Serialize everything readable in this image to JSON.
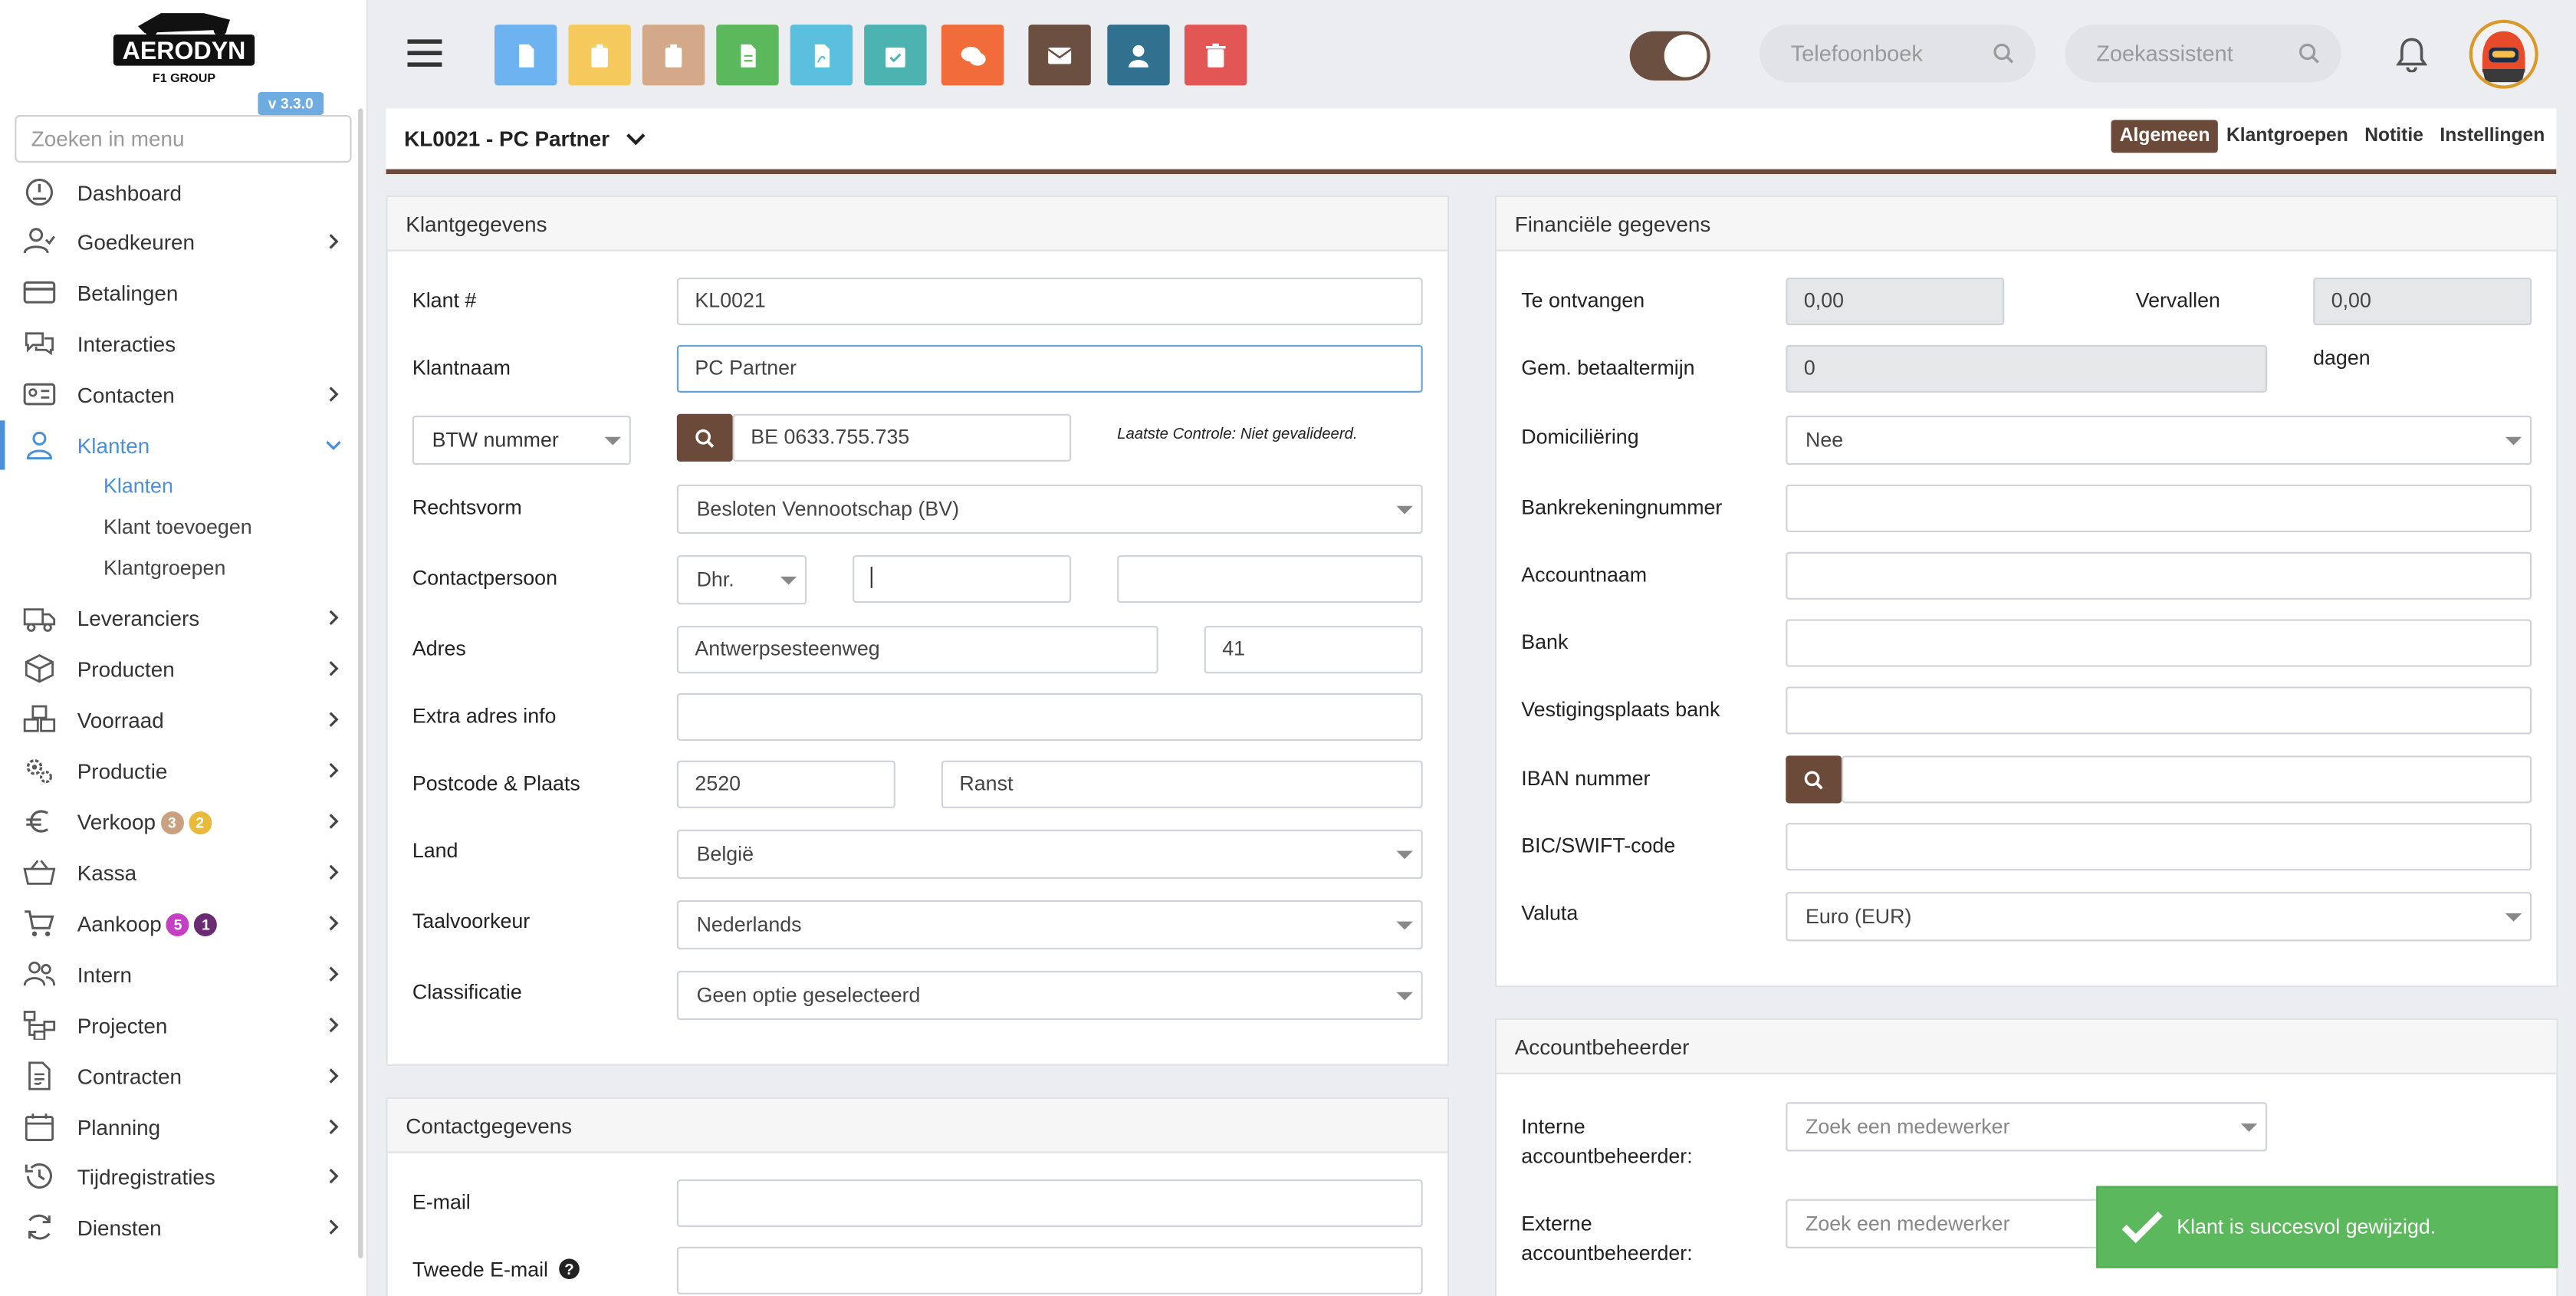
{
  "app": {
    "brand": "AERODYN",
    "brand_sub": "F1 GROUP",
    "version": "v 3.3.0"
  },
  "sidebar": {
    "search_placeholder": "Zoeken in menu",
    "items": [
      {
        "label": "Dashboard",
        "icon": "gauge-icon"
      },
      {
        "label": "Goedkeuren",
        "icon": "user-check-icon"
      },
      {
        "label": "Betalingen",
        "icon": "credit-card-icon"
      },
      {
        "label": "Interacties",
        "icon": "chat-bubbles-icon"
      },
      {
        "label": "Contacten",
        "icon": "id-card-icon"
      },
      {
        "label": "Klanten",
        "icon": "user-icon"
      },
      {
        "label": "Leveranciers",
        "icon": "truck-icon"
      },
      {
        "label": "Producten",
        "icon": "box-icon"
      },
      {
        "label": "Voorraad",
        "icon": "boxes-icon"
      },
      {
        "label": "Productie",
        "icon": "cogs-icon"
      },
      {
        "label": "Verkoop",
        "icon": "euro-icon",
        "badges": [
          "3",
          "2"
        ]
      },
      {
        "label": "Kassa",
        "icon": "basket-icon"
      },
      {
        "label": "Aankoop",
        "icon": "cart-icon",
        "badges": [
          "5",
          "1"
        ]
      },
      {
        "label": "Intern",
        "icon": "users-icon"
      },
      {
        "label": "Projecten",
        "icon": "sitemap-icon"
      },
      {
        "label": "Contracten",
        "icon": "contract-icon"
      },
      {
        "label": "Planning",
        "icon": "calendar-icon"
      },
      {
        "label": "Tijdregistraties",
        "icon": "history-icon"
      },
      {
        "label": "Diensten",
        "icon": "sync-icon"
      }
    ],
    "sub_items": [
      "Klanten",
      "Klant toevoegen",
      "Klantgroepen"
    ],
    "badge_colors": {
      "verkoop_1": "#c9a080",
      "verkoop_2": "#e8b93a",
      "aankoop_1": "#c43fc4",
      "aankoop_2": "#6a2b73"
    }
  },
  "topbar": {
    "buttons": [
      {
        "icon": "document-icon",
        "color": "#6db3f0"
      },
      {
        "icon": "clipboard-icon",
        "color": "#f5c95c"
      },
      {
        "icon": "clipboard-alt-icon",
        "color": "#d3a98a"
      },
      {
        "icon": "spreadsheet-icon",
        "color": "#5cb85c"
      },
      {
        "icon": "pdf-icon",
        "color": "#5bc0de"
      },
      {
        "icon": "calendar-check-icon",
        "color": "#4db3b0"
      },
      {
        "icon": "comments-icon",
        "color": "#f26b3a"
      },
      {
        "icon": "envelope-icon",
        "color": "#6b5042"
      },
      {
        "icon": "user-icon",
        "color": "#31708f"
      },
      {
        "icon": "trash-icon",
        "color": "#e35656"
      }
    ],
    "phonebook_placeholder": "Telefoonboek",
    "assistant_placeholder": "Zoekassistent"
  },
  "page": {
    "title": "KL0021 - PC Partner",
    "tabs": [
      "Algemeen",
      "Klantgroepen",
      "Notitie",
      "Instellingen"
    ]
  },
  "klantgegevens": {
    "header": "Klantgegevens",
    "klant_nr_label": "Klant #",
    "klant_nr": "KL0021",
    "klantnaam_label": "Klantnaam",
    "klantnaam": "PC Partner",
    "btw_type": "BTW nummer",
    "btw_value": "BE 0633.755.735",
    "btw_note": "Laatste Controle: Niet gevalideerd.",
    "rechtsvorm_label": "Rechtsvorm",
    "rechtsvorm": "Besloten Vennootschap (BV)",
    "contact_label": "Contactpersoon",
    "contact_title": "Dhr.",
    "adres_label": "Adres",
    "straat": "Antwerpsesteenweg",
    "huisnr": "41",
    "extra_label": "Extra adres info",
    "postcode_label": "Postcode & Plaats",
    "postcode": "2520",
    "plaats": "Ranst",
    "land_label": "Land",
    "land": "België",
    "taal_label": "Taalvoorkeur",
    "taal": "Nederlands",
    "class_label": "Classificatie",
    "classificatie": "Geen optie geselecteerd"
  },
  "contactgegevens": {
    "header": "Contactgegevens",
    "email_label": "E-mail",
    "email2_label": "Tweede E-mail"
  },
  "financieel": {
    "header": "Financiële gegevens",
    "te_ontvangen_label": "Te ontvangen",
    "te_ontvangen": "0,00",
    "vervallen_label": "Vervallen",
    "vervallen": "0,00",
    "betaaltermijn_label": "Gem. betaaltermijn",
    "betaaltermijn": "0",
    "dagen": "dagen",
    "domiciliering_label": "Domiciliëring",
    "domiciliering": "Nee",
    "bankrek_label": "Bankrekeningnummer",
    "accountnaam_label": "Accountnaam",
    "bank_label": "Bank",
    "vestiging_label": "Vestigingsplaats bank",
    "iban_label": "IBAN nummer",
    "bic_label": "BIC/SWIFT-code",
    "valuta_label": "Valuta",
    "valuta": "Euro (EUR)"
  },
  "accountbeheerder": {
    "header": "Accountbeheerder",
    "intern_label_1": "Interne",
    "intern_label_2": "accountbeheerder:",
    "extern_label_1": "Externe",
    "extern_label_2": "accountbeheerder:",
    "placeholder": "Zoek een medewerker"
  },
  "toast": {
    "message": "Klant is succesvol gewijzigd."
  }
}
